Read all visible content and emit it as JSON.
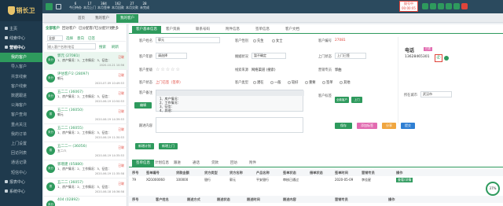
{
  "app": {
    "logo_text": "销长卫"
  },
  "sidebar": {
    "items": [
      {
        "label": "主页",
        "type": "top"
      },
      {
        "label": "线索中心",
        "type": "top"
      },
      {
        "label": "营销中心",
        "type": "top",
        "state": "sel"
      },
      {
        "label": "我的客户",
        "type": "sub",
        "state": "active"
      },
      {
        "label": "导入客户",
        "type": "sub"
      },
      {
        "label": "共享线索",
        "type": "sub"
      },
      {
        "label": "客户线索",
        "type": "sub"
      },
      {
        "label": "数据跟进",
        "type": "sub"
      },
      {
        "label": "公海客户",
        "type": "sub"
      },
      {
        "label": "客户查询",
        "type": "sub"
      },
      {
        "label": "重点关注",
        "type": "sub"
      },
      {
        "label": "我的订单",
        "type": "sub"
      },
      {
        "label": "上门设置",
        "type": "sub"
      },
      {
        "label": "回访列表",
        "type": "sub"
      },
      {
        "label": "通话记录",
        "type": "sub"
      },
      {
        "label": "短信中心",
        "type": "sub"
      },
      {
        "label": "报表中心",
        "type": "top"
      },
      {
        "label": "系统中心",
        "type": "top"
      }
    ]
  },
  "topbar": {
    "stats": [
      {
        "label": "今日待办",
        "value": "6"
      },
      {
        "label": "本月上门",
        "value": "17"
      },
      {
        "label": "本月签单",
        "value": "384"
      },
      {
        "label": "本月回款",
        "value": "162"
      },
      {
        "label": "本月欠款",
        "value": "27"
      },
      {
        "label": "未完成",
        "value": "28"
      }
    ],
    "timer_label": "拨号中",
    "timer_value": "00:00:05"
  },
  "tabs": [
    {
      "label": "首页"
    },
    {
      "label": "我的客户"
    },
    {
      "label": "我的客户"
    }
  ],
  "list": {
    "tabs": [
      "全部客户",
      "回访客户",
      "已分配客户",
      "已分配计划",
      "更多"
    ],
    "filter_label": "全部",
    "filter_options": [
      "选择",
      "意向",
      "已签"
    ],
    "search_placeholder": "输入客户名称/电话",
    "search_button": "搜索",
    "refresh": "刷新",
    "items": [
      {
        "avatar": "未分",
        "name": "郭元 (27081)",
        "desc": "1、房产情况：2、工作情况：3、征信：",
        "date": "2020-10-21 10:56",
        "tag": "已联"
      },
      {
        "avatar": "未分",
        "name": "评估客户2 (28097)",
        "desc": "郭元",
        "date": "2020-07-09 10:49:53",
        "tag": "已联"
      },
      {
        "avatar": "未分",
        "name": "五二二 (36067)",
        "desc": "1、房产情况：2、工作情况：3、征信：",
        "date": "2020-06-19 10:50:53",
        "tag": "已联"
      },
      {
        "avatar": "拨",
        "name": "五二二 (36050)",
        "desc": "郭元",
        "date": "2020-06-19 14:39:53",
        "tag": "已联"
      },
      {
        "avatar": "未分",
        "name": "五二二 (36055)",
        "desc": "1、房产情况：2、工作情况：3、征信：",
        "date": "2020-06-19 11:30:53",
        "tag": "已联"
      },
      {
        "avatar": "拨",
        "name": "五二二一 (36056)",
        "desc": "五二八",
        "date": "2020-06-19 14:35:53",
        "tag": "已联"
      },
      {
        "avatar": "未分",
        "name": "郭增建 (05880)",
        "desc": "1、房产情况：2、工作情况：3、征信：",
        "date": "2020-06-19 11:35:58",
        "tag": "已联"
      },
      {
        "avatar": "拨",
        "name": "五二二 (36057)",
        "desc": "1、房产情况：2、工作情况：3、征信：",
        "date": "2020-06-18 16:36:58",
        "tag": "已联"
      },
      {
        "avatar": "未分",
        "name": "404 (02892)",
        "desc": "",
        "date": "",
        "tag": ""
      }
    ]
  },
  "detail": {
    "tabs": [
      "客户基本信息",
      "客户资质",
      "联系号码",
      "附件信息",
      "签单信息",
      "客户文档"
    ],
    "fields": {
      "name_label": "客户姓名",
      "name_value": "郭元",
      "gender_label": "客户性别",
      "gender_opts": [
        "先生",
        "女士"
      ],
      "number_label": "客户编号",
      "number_value": "27081",
      "age_label": "客户年龄",
      "age_value": "请选择",
      "marital_label": "婚姻状况",
      "marital_value": "暂不确定",
      "visit_label": "上门状态",
      "visit_value": "上门已签",
      "level_label": "客户星级",
      "source_label": "线索来源",
      "source_value": "网络渠道 (搜索)",
      "manager_label": "营销专员",
      "manager_value": "郭曲",
      "status_label": "客户状态",
      "status_value": "上门已签（签单）",
      "type_label": "客户类型",
      "type_opts": [
        "潜在",
        "一般",
        "较好",
        "重要",
        "签单",
        "其他"
      ],
      "note_label": "客户备注",
      "note_lines": [
        "1、房产情况：",
        "2、工作情况：",
        "3、征信：",
        "4、其他："
      ],
      "remark_label": "跟进内容",
      "tags_label": "客户标签",
      "tags": [
        "全款客户",
        "上门"
      ],
      "city_label": "所在城市",
      "city_value": "武汉市"
    },
    "call": {
      "title": "电话",
      "badge": "已拨",
      "number": "13628465301"
    },
    "action_buttons": [
      "保存",
      "添加标签",
      "分享",
      "提交"
    ],
    "sub_buttons": [
      "新增计划",
      "新增上门"
    ],
    "bottom_tabs": [
      "签单信息",
      "计划信息",
      "跟进",
      "通话",
      "贷款",
      "回访",
      "附件"
    ],
    "table": {
      "headers": [
        "序号",
        "签单编号",
        "贷款金额",
        "贷方类型",
        "贷方名称",
        "产品名称",
        "签单状态",
        "借单状态",
        "签单时间",
        "营销专员",
        "操作"
      ],
      "rows": [
        [
          "79",
          "XD1000060",
          "100000",
          "银行",
          "郭元",
          "平安银行",
          "审核已通过",
          "",
          "2020-05-09",
          "李佳星",
          "查看/详情"
        ]
      ],
      "headers2": [
        "序号",
        "客户姓名",
        "跟进方式",
        "跟进状态",
        "跟进时间",
        "跟进内容",
        "营销专员",
        "操作"
      ]
    },
    "progress": {
      "value": "37%"
    }
  }
}
